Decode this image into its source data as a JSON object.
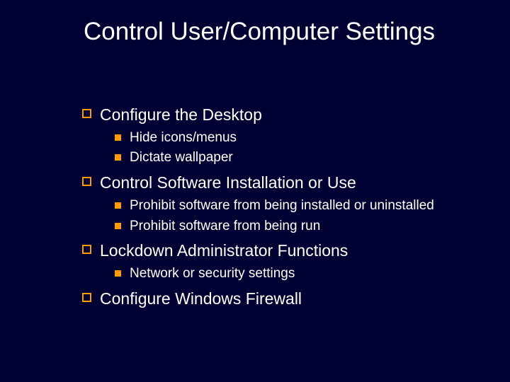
{
  "title": "Control User/Computer Settings",
  "items": [
    {
      "label": "Configure the Desktop",
      "children": [
        "Hide icons/menus",
        "Dictate wallpaper"
      ]
    },
    {
      "label": "Control Software Installation or Use",
      "children": [
        "Prohibit software from being installed or uninstalled",
        "Prohibit software from being run"
      ]
    },
    {
      "label": "Lockdown Administrator Functions",
      "children": [
        "Network or security settings"
      ]
    },
    {
      "label": "Configure Windows Firewall",
      "children": []
    }
  ],
  "stripe_heights": [
    50,
    46,
    42,
    38,
    34,
    30,
    26,
    22,
    18,
    14
  ]
}
